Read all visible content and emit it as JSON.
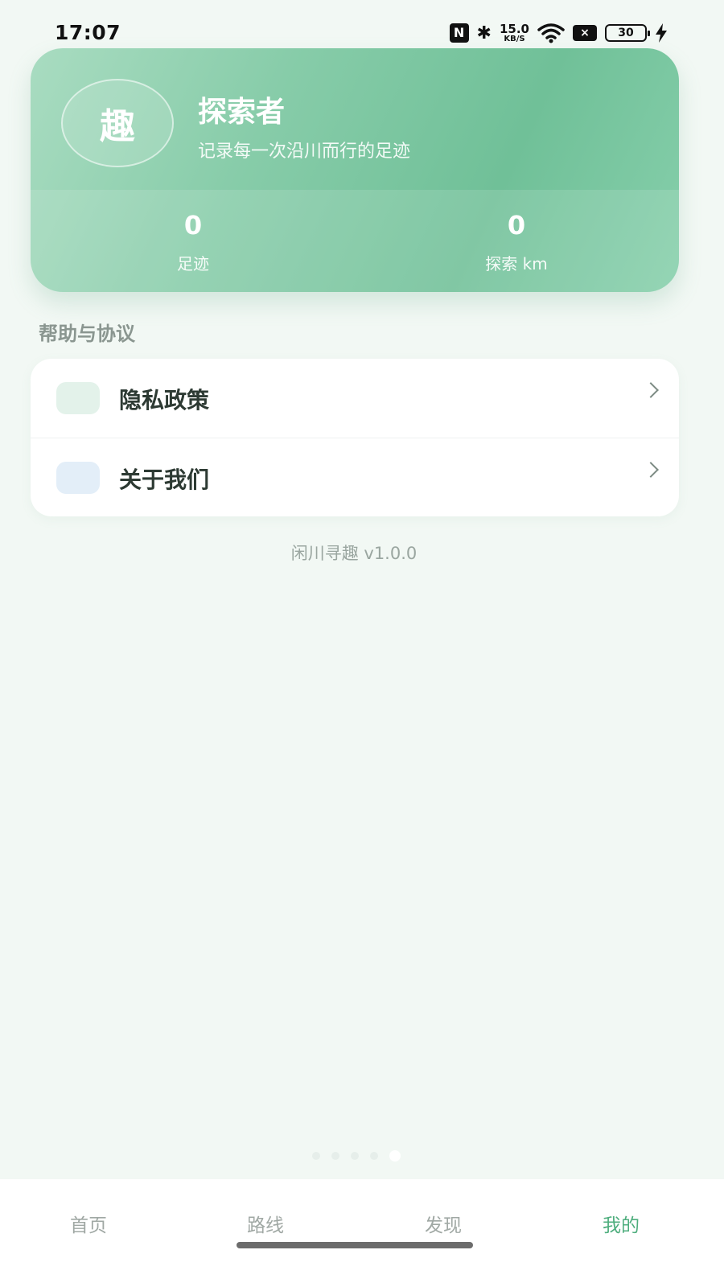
{
  "status_bar": {
    "time": "17:07",
    "nfc_icon": "N",
    "net_speed_value": "15.0",
    "net_speed_unit": "KB/S",
    "battery_level": "30"
  },
  "profile": {
    "avatar_char": "趣",
    "name": "探索者",
    "motto": "记录每一次沿川而行的足迹",
    "stats": [
      {
        "value": "0",
        "label": "足迹"
      },
      {
        "value": "0",
        "label": "探索 km"
      }
    ]
  },
  "help_section": {
    "title": "帮助与协议",
    "items": [
      {
        "label": "隐私政策"
      },
      {
        "label": "关于我们"
      }
    ]
  },
  "version_text": "闲川寻趣 v1.0.0",
  "tab_bar": {
    "tabs": [
      {
        "label": "首页"
      },
      {
        "label": "路线"
      },
      {
        "label": "发现"
      },
      {
        "label": "我的"
      }
    ],
    "active_color": "#4fae7e"
  },
  "colors": {
    "card_gradient_start": "#a9dcc1",
    "card_gradient_end": "#70c098",
    "background": "#f2f8f4"
  }
}
